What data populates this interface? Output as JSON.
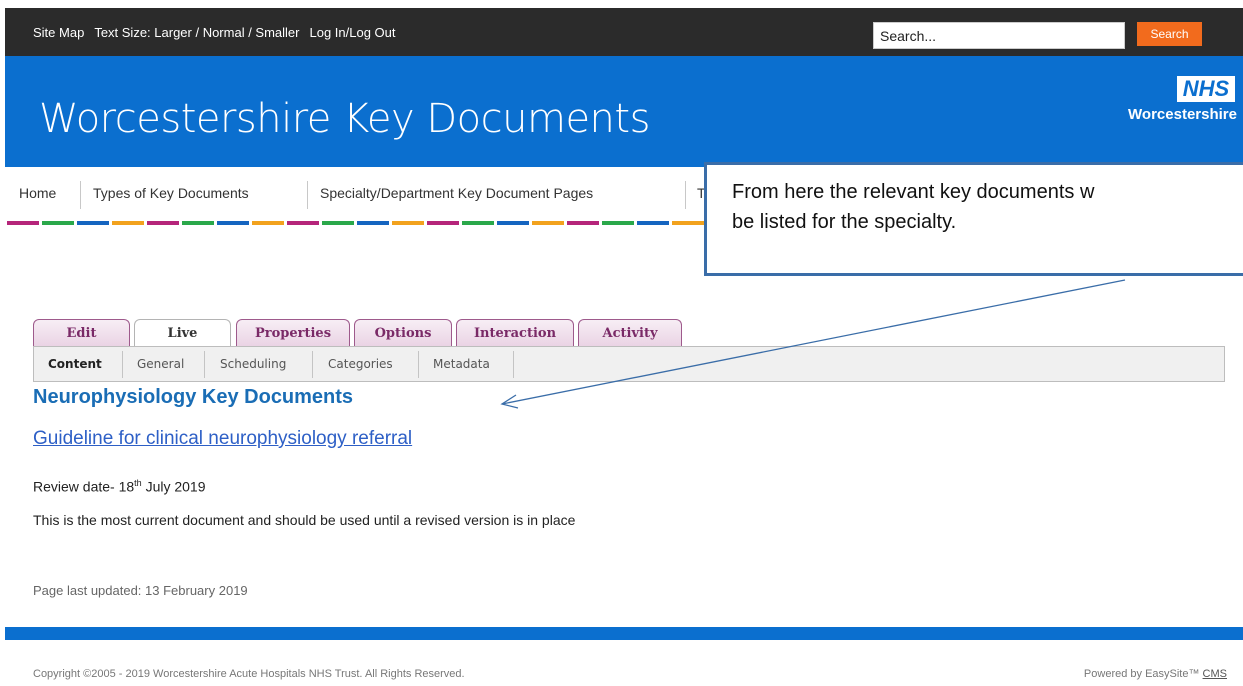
{
  "topbar": {
    "links": [
      "Site Map",
      "Text Size: Larger / Normal / Smaller",
      "Log In/Log Out"
    ],
    "search_placeholder": "Search...",
    "search_button": "Search"
  },
  "header": {
    "title": "Worcestershire Key Documents",
    "logo_text": "NHS",
    "logo_sub": "Worcestershire"
  },
  "mainnav": {
    "items": [
      "Home",
      "Types of Key Documents",
      "Specialty/Department Key Document Pages",
      "T"
    ]
  },
  "callout": {
    "line1": "From here the relevant key documents w",
    "line2": "be listed for the specialty."
  },
  "admin": {
    "tabs": [
      "Edit",
      "Live",
      "Properties",
      "Options",
      "Interaction",
      "Activity"
    ],
    "active_tab": "Live",
    "subtabs": [
      "Content",
      "General",
      "Scheduling",
      "Categories",
      "Metadata"
    ],
    "active_subtab": "Content"
  },
  "content": {
    "heading": "Neurophysiology Key Documents",
    "link": "Guideline for clinical neurophysiology referral",
    "review_prefix": "Review date- 18",
    "review_sup": "th",
    "review_suffix": " July 2019",
    "current_note": "This is the most current document and should be used until a revised version is in place",
    "last_updated": "Page last updated: 13 February 2019"
  },
  "footer": {
    "copyright": "Copyright ©2005 - 2019 Worcestershire Acute Hospitals NHS Trust. All Rights Reserved.",
    "powered_prefix": "Powered by EasySite™ ",
    "powered_link": "CMS"
  },
  "colors": {
    "header_blue": "#0b6fcf",
    "search_orange": "#f26b1d",
    "tab_purple": "#7a2a67",
    "heading_blue": "#1a6db5"
  }
}
